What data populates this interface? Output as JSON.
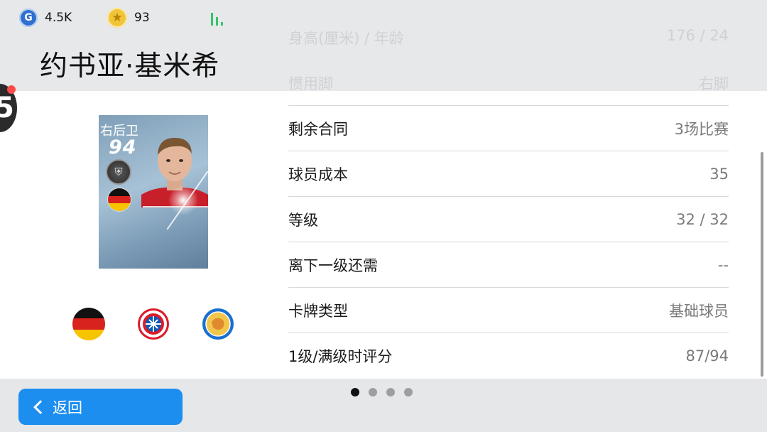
{
  "currency": {
    "gp_icon": "gp-coin-icon",
    "gp_value": "4.5K",
    "coins_icon": "star-coin-icon",
    "coins_value": "93"
  },
  "player": {
    "name": "约书亚·基米希",
    "card_position": "右后卫",
    "card_rating": "94"
  },
  "faded_rows": [
    {
      "label": "身高(厘米) / 年龄",
      "value": "176 / 24"
    },
    {
      "label": "惯用脚",
      "value": "右脚"
    }
  ],
  "stats": [
    {
      "label": "剩余合同",
      "value": "3场比赛"
    },
    {
      "label": "球员成本",
      "value": "35"
    },
    {
      "label": "等级",
      "value": "32 / 32"
    },
    {
      "label": "离下一级还需",
      "value": "--"
    },
    {
      "label": "卡牌类型",
      "value": "基础球员"
    },
    {
      "label": "1级/满级时评分",
      "value": "87/94"
    }
  ],
  "badges": [
    "germany-flag-icon",
    "fc-bayern-munchen-logo",
    "europe-league-logo"
  ],
  "footer": {
    "back_label": "返回",
    "pages": 4,
    "active_page": 1
  },
  "colors": {
    "accent": "#1c8ef0",
    "header_bg": "#e7e8ea"
  }
}
